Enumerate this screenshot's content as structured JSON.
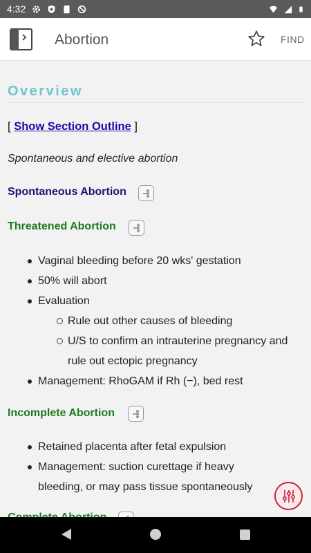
{
  "status_bar": {
    "time": "4:32",
    "icons_left": [
      "gear-icon",
      "shield-icon",
      "sd-card-icon",
      "no-sync-icon"
    ],
    "icons_right": [
      "wifi-icon",
      "signal-icon",
      "battery-icon"
    ]
  },
  "app_bar": {
    "title": "Abortion",
    "find_label": "FIND",
    "icons": [
      "book-outline-icon",
      "star-icon"
    ]
  },
  "content": {
    "section_title": "Overview",
    "outline_open": "[",
    "outline_link": "Show Section Outline",
    "outline_close": "]",
    "subtitle": "Spontaneous and elective abortion",
    "headings": {
      "spontaneous": "Spontaneous Abortion",
      "threatened": "Threatened Abortion",
      "incomplete": "Incomplete Abortion",
      "complete": "Complete Abortion"
    },
    "threatened_bullets": {
      "b1": "Vaginal bleeding before 20 wks' gestation",
      "b2": "50% will abort",
      "b3": "Evaluation",
      "sub1": "Rule out other causes of bleeding",
      "sub2": "U/S to confirm an intrauterine pregnancy and rule out ectopic pregnancy",
      "b4": "Management: RhoGAM if Rh (−), bed rest"
    },
    "incomplete_bullets": {
      "b1": "Retained placenta after fetal expulsion",
      "b2": "Management: suction curettage if heavy bleeding, or may pass tissue spontaneously"
    }
  },
  "colors": {
    "section_title": "#6fc5d0",
    "heading_navy": "#141475",
    "heading_green": "#1e7a1e",
    "link": "#1a0dab",
    "fab_accent": "#c8233c"
  }
}
